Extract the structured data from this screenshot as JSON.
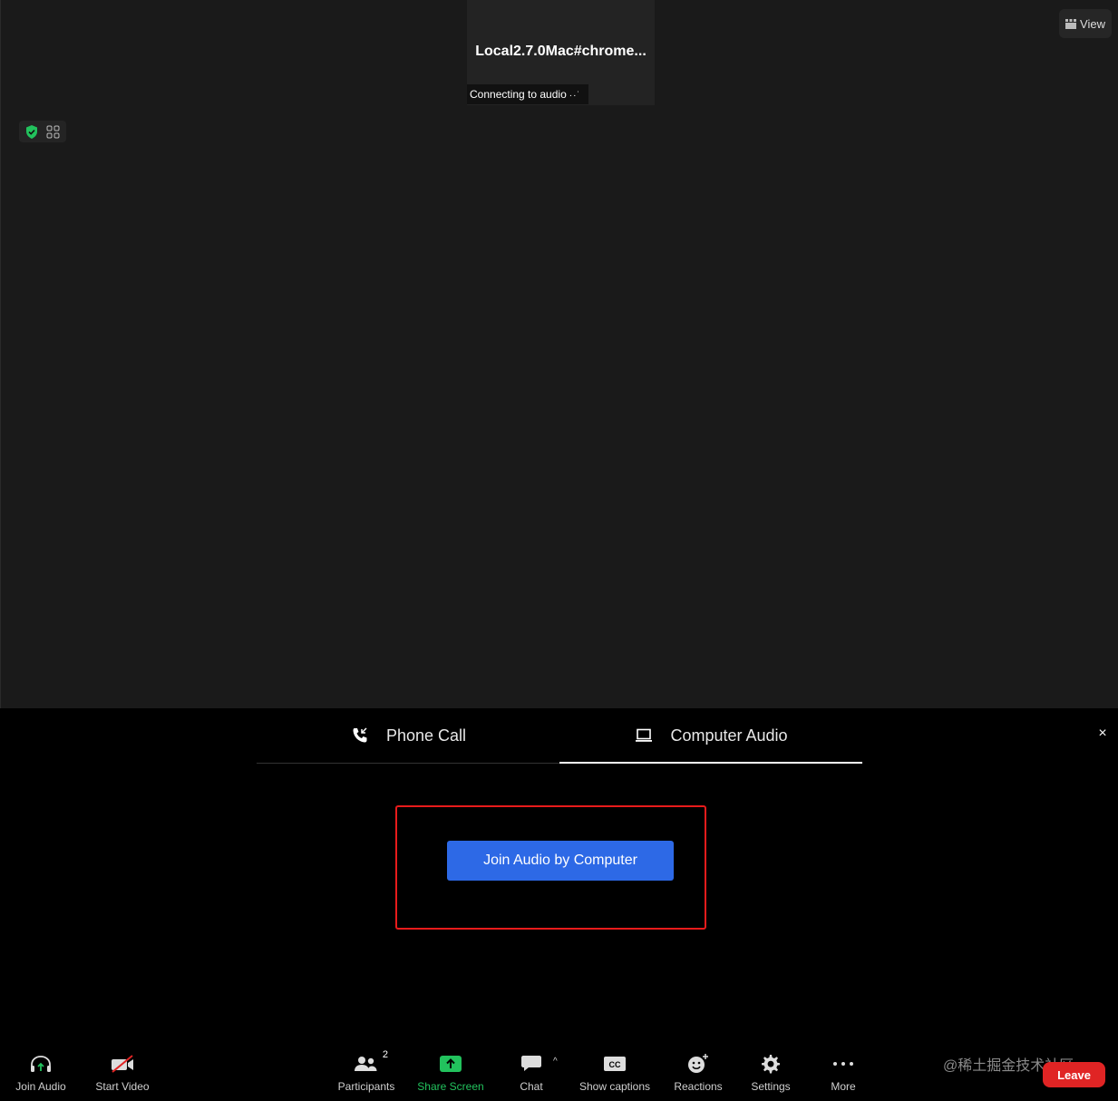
{
  "participant_tile": {
    "name": "Local2.7.0Mac#chrome...",
    "status": "Connecting to audio",
    "status_dots": "··˙"
  },
  "view_button": {
    "label": "View"
  },
  "audio_dialog": {
    "tabs": [
      {
        "label": "Phone Call",
        "icon": "phone-call-icon",
        "active": false
      },
      {
        "label": "Computer Audio",
        "icon": "laptop-icon",
        "active": true
      }
    ],
    "close_icon": "×",
    "join_button_label": "Join Audio by Computer",
    "highlight_color": "#e81b1b",
    "join_button_color": "#2d69e6"
  },
  "toolbar": {
    "join_audio": "Join Audio",
    "start_video": "Start Video",
    "participants": "Participants",
    "participants_count": "2",
    "share_screen": "Share Screen",
    "chat": "Chat",
    "chat_caret": "^",
    "show_captions": "Show captions",
    "reactions": "Reactions",
    "settings": "Settings",
    "more": "More",
    "leave": "Leave",
    "share_color": "#22c25d",
    "leave_color": "#e02424"
  },
  "watermark": "@稀土掘金技术社区"
}
